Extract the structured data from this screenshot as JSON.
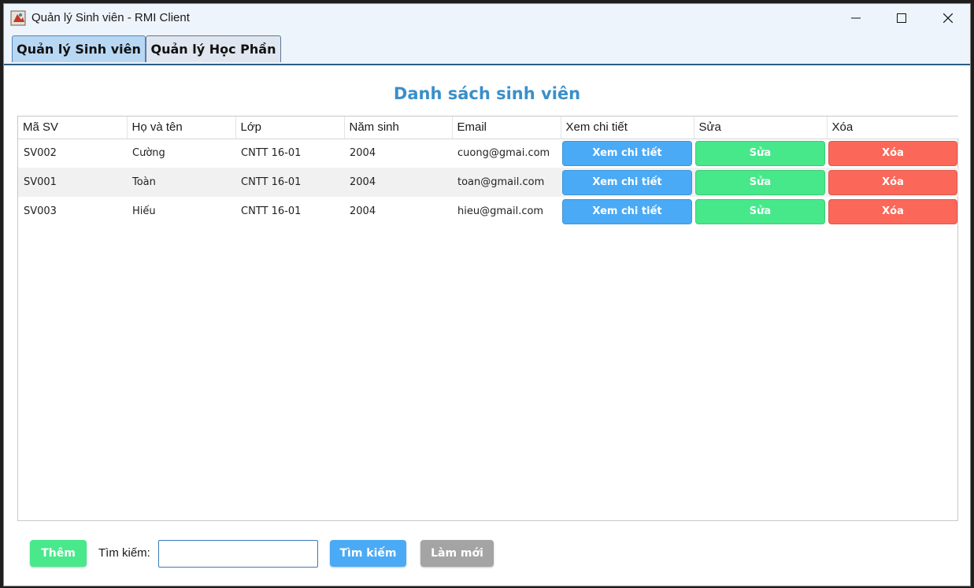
{
  "window": {
    "title": "Quản lý Sinh viên - RMI Client",
    "controls": [
      "minimize-icon",
      "maximize-icon",
      "close-icon"
    ]
  },
  "tabs": [
    {
      "label": "Quản lý Sinh viên",
      "active": true
    },
    {
      "label": "Quản lý Học Phần",
      "active": false
    }
  ],
  "main": {
    "heading": "Danh sách sinh viên",
    "columns": [
      "Mã SV",
      "Họ và tên",
      "Lớp",
      "Năm sinh",
      "Email",
      "Xem chi tiết",
      "Sửa",
      "Xóa"
    ],
    "rows": [
      {
        "id": "SV002",
        "name": "Cường",
        "class": "CNTT 16-01",
        "year": "2004",
        "email": "cuong@gmai.com",
        "view": "Xem chi tiết",
        "edit": "Sửa",
        "delete": "Xóa"
      },
      {
        "id": "SV001",
        "name": "Toàn",
        "class": "CNTT 16-01",
        "year": "2004",
        "email": "toan@gmail.com",
        "view": "Xem chi tiết",
        "edit": "Sửa",
        "delete": "Xóa"
      },
      {
        "id": "SV003",
        "name": "Hiếu",
        "class": "CNTT 16-01",
        "year": "2004",
        "email": "hieu@gmail.com",
        "view": "Xem chi tiết",
        "edit": "Sửa",
        "delete": "Xóa"
      }
    ]
  },
  "footer": {
    "add_label": "Thêm",
    "search_label": "Tìm kiếm:",
    "search_value": "",
    "search_button": "Tìm kiếm",
    "refresh_button": "Làm mới"
  },
  "colors": {
    "heading": "#3a8fca",
    "view_button": "#4aaaf5",
    "edit_button": "#46e88a",
    "delete_button": "#fb6759",
    "refresh_button": "#a4a4a4"
  }
}
